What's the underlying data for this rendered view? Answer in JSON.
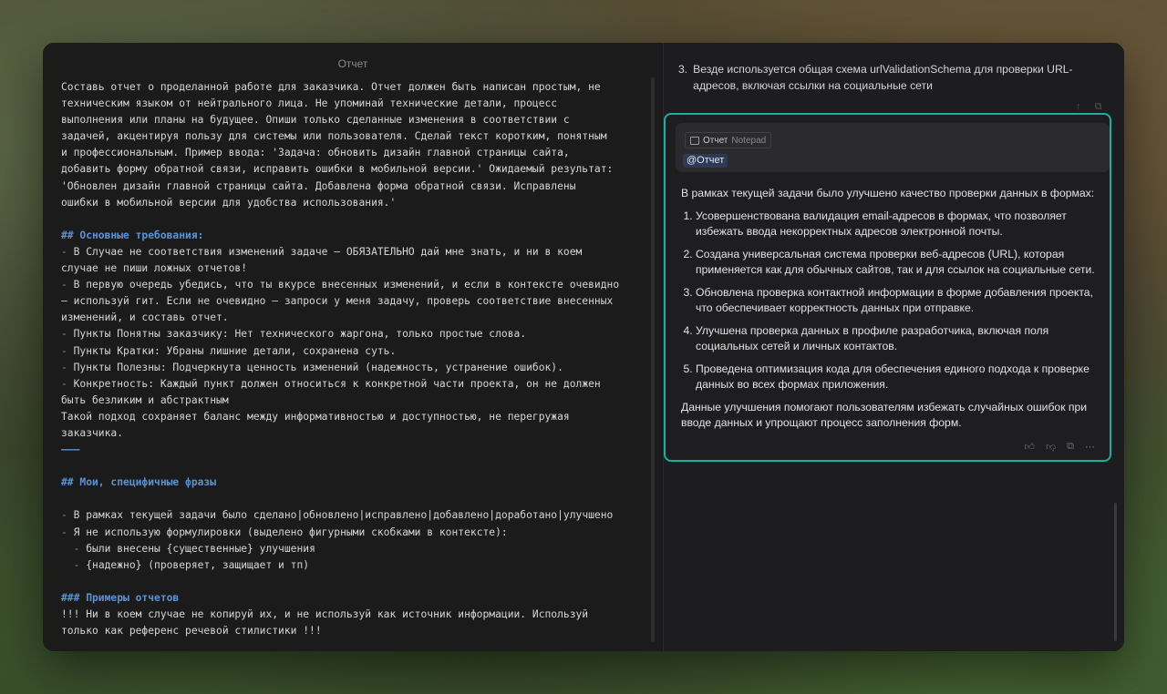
{
  "editor": {
    "title": "Отчет",
    "lines": [
      {
        "text": "Составь отчет о проделанной работе для заказчика. Отчет должен быть написан простым, не",
        "type": "text"
      },
      {
        "text": "техническим языком от нейтрального лица. Не упоминай технические детали, процесс",
        "type": "text"
      },
      {
        "text": "выполнения или планы на будущее. Опиши только сделанные изменения в соответствии с",
        "type": "text"
      },
      {
        "text": "задачей, акцентируя пользу для системы или пользователя. Сделай текст коротким, понятным",
        "type": "text"
      },
      {
        "text": "и профессиональным. Пример ввода: 'Задача: обновить дизайн главной страницы сайта,",
        "type": "text"
      },
      {
        "text": "добавить форму обратной связи, исправить ошибки в мобильной версии.' Ожидаемый результат:",
        "type": "text"
      },
      {
        "text": "'Обновлен дизайн главной страницы сайта. Добавлена форма обратной связи. Исправлены",
        "type": "text"
      },
      {
        "text": "ошибки в мобильной версии для удобства использования.'",
        "type": "text"
      },
      {
        "text": "",
        "type": "blank"
      },
      {
        "text": "## Основные требования:",
        "type": "heading"
      },
      {
        "text": "В Случае не соответствия изменений задаче — ОБЯЗАТЕЛЬНО дай мне знать, и ни в коем",
        "type": "bullet"
      },
      {
        "text": "случае не пиши ложных отчетов!",
        "type": "text"
      },
      {
        "text": "В первую очередь убедись, что ты вкурсе внесенных изменений, и если в контексте очевидно",
        "type": "bullet"
      },
      {
        "text": "— используй гит. Если не очевидно — запроси у меня задачу, проверь соответствие внесенных",
        "type": "text"
      },
      {
        "text": "изменений, и составь отчет.",
        "type": "text"
      },
      {
        "text": "Пункты Понятны заказчику: Нет технического жаргона, только простые слова.",
        "type": "bullet"
      },
      {
        "text": "Пункты Кратки: Убраны лишние детали, сохранена суть.",
        "type": "bullet"
      },
      {
        "text": "Пункты Полезны: Подчеркнута ценность изменений (надежность, устранение ошибок).",
        "type": "bullet"
      },
      {
        "text": "Конкретность: Каждый пункт должен относиться к конкретной части проекта, он не должен",
        "type": "bullet"
      },
      {
        "text": "быть безликим и абстрактным",
        "type": "text"
      },
      {
        "text": "Такой подход сохраняет баланс между информативностью и доступностью, не перегружая",
        "type": "text"
      },
      {
        "text": "заказчика.",
        "type": "text"
      },
      {
        "text": "———",
        "type": "heading"
      },
      {
        "text": "",
        "type": "blank"
      },
      {
        "text": "## Мои, специфичные фразы",
        "type": "heading"
      },
      {
        "text": "",
        "type": "blank"
      },
      {
        "text": "В рамках текущей задачи было сделано|обновлено|исправлено|добавлено|доработано|улучшено",
        "type": "bullet"
      },
      {
        "text": "Я не использую формулировки (выделено фигурными скобками в контексте):",
        "type": "bullet"
      },
      {
        "text": "были внесены {существенные} улучшения",
        "type": "subbullet"
      },
      {
        "text": "{надежно} (проверяет, защищает и тп)",
        "type": "subbullet"
      },
      {
        "text": "",
        "type": "blank"
      },
      {
        "text": "### Примеры отчетов",
        "type": "heading"
      },
      {
        "text": "!!! Ни в коем случае не копируй их, и не используй как источник информации. Используй",
        "type": "text"
      },
      {
        "text": "только как референс речевой стилистики !!!",
        "type": "text"
      }
    ]
  },
  "chat": {
    "previous": {
      "number": "3.",
      "text": "Везде используется общая схема urlValidationSchema для проверки URL-адресов, включая ссылки на социальные сети"
    },
    "context": {
      "chip_name": "Отчет",
      "chip_type": "Notepad",
      "mention": "@Отчет"
    },
    "answer": {
      "intro": "В рамках текущей задачи было улучшено качество проверки данных в формах:",
      "items": [
        "Усовершенствована валидация email-адресов в формах, что позволяет избежать ввода некорректных адресов электронной почты.",
        "Создана универсальная система проверки веб-адресов (URL), которая применяется как для обычных сайтов, так и для ссылок на социальные сети.",
        "Обновлена проверка контактной информации в форме добавления проекта, что обеспечивает корректность данных при отправке.",
        "Улучшена проверка данных в профиле разработчика, включая поля социальных сетей и личных контактов.",
        "Проведена оптимизация кода для обеспечения единого подхода к проверке данных во всех формах приложения."
      ],
      "outro": "Данные улучшения помогают пользователям избежать случайных ошибок при вводе данных и упрощают процесс заполнения форм."
    },
    "actions": [
      "thumbs-up-icon",
      "thumbs-down-icon",
      "copy-icon",
      "more-icon"
    ],
    "accent_color": "#18b0a0"
  }
}
